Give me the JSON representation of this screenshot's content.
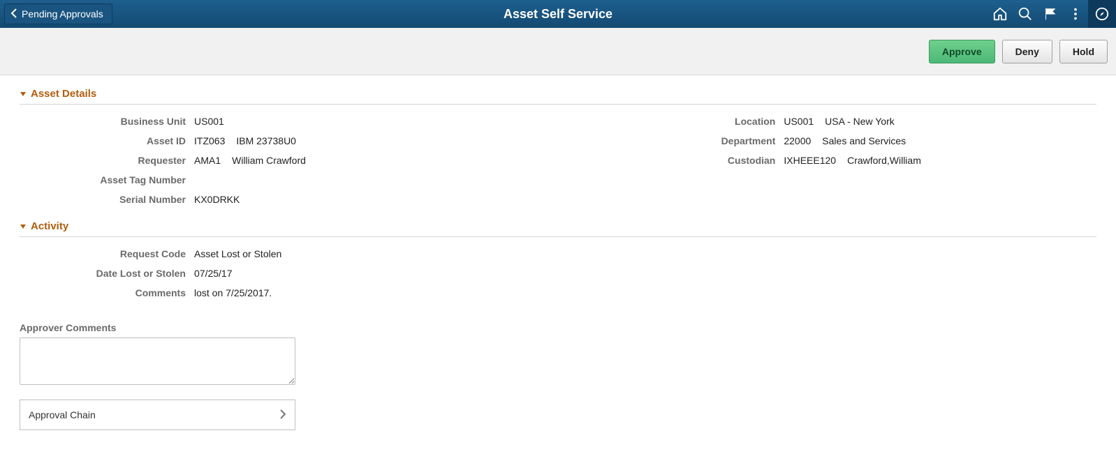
{
  "header": {
    "back_label": "Pending Approvals",
    "title": "Asset Self Service"
  },
  "actions": {
    "approve": "Approve",
    "deny": "Deny",
    "hold": "Hold"
  },
  "sections": {
    "asset_details": {
      "title": "Asset Details",
      "left": {
        "business_unit": {
          "label": "Business Unit",
          "code": "US001"
        },
        "asset_id": {
          "label": "Asset ID",
          "code": "ITZ063",
          "desc": "IBM 23738U0"
        },
        "requester": {
          "label": "Requester",
          "code": "AMA1",
          "desc": "William Crawford"
        },
        "asset_tag": {
          "label": "Asset Tag Number",
          "value": ""
        },
        "serial": {
          "label": "Serial Number",
          "value": "KX0DRKK"
        }
      },
      "right": {
        "location": {
          "label": "Location",
          "code": "US001",
          "desc": "USA - New York"
        },
        "department": {
          "label": "Department",
          "code": "22000",
          "desc": "Sales and Services"
        },
        "custodian": {
          "label": "Custodian",
          "code": "IXHEEE120",
          "desc": "Crawford,William"
        }
      }
    },
    "activity": {
      "title": "Activity",
      "request_code": {
        "label": "Request Code",
        "value": "Asset Lost or Stolen"
      },
      "date_lost": {
        "label": "Date Lost or Stolen",
        "value": "07/25/17"
      },
      "comments": {
        "label": "Comments",
        "value": "lost on 7/25/2017."
      }
    }
  },
  "approver_comments_label": "Approver Comments",
  "approval_chain_label": "Approval Chain"
}
